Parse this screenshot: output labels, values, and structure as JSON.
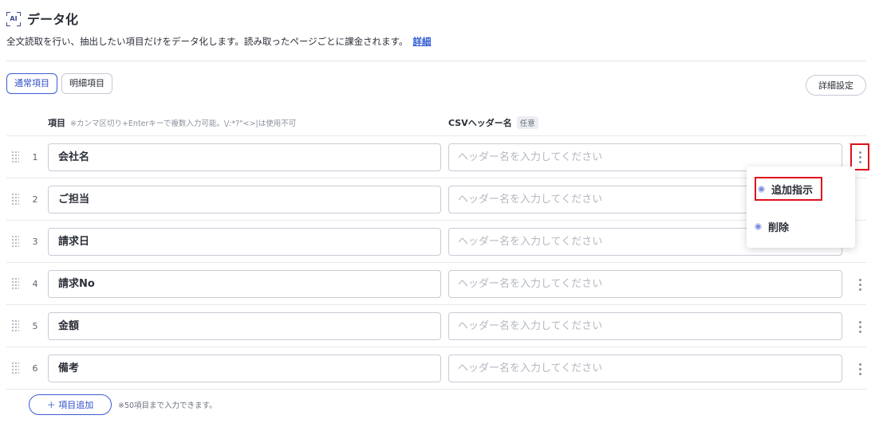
{
  "header": {
    "title": "データ化",
    "ai_label": "AI",
    "description": "全文読取を行い、抽出したい項目だけをデータ化します。読み取ったページごとに課金されます。",
    "detail_link": "詳細"
  },
  "tabs": [
    {
      "label": "通常項目",
      "active": true
    },
    {
      "label": "明細項目",
      "active": false
    }
  ],
  "detail_settings_label": "詳細設定",
  "columns": {
    "item_label": "項目",
    "item_note": "※カンマ区切り+Enterキーで複数入力可能。\\/:*?\"<>|は使用不可",
    "csv_label": "CSVヘッダー名",
    "csv_optional": "任意"
  },
  "rows": [
    {
      "num": "1",
      "name": "会社名",
      "csv_placeholder": "ヘッダー名を入力してください"
    },
    {
      "num": "2",
      "name": "ご担当",
      "csv_placeholder": "ヘッダー名を入力してください"
    },
    {
      "num": "3",
      "name": "請求日",
      "csv_placeholder": "ヘッダー名を入力してください"
    },
    {
      "num": "4",
      "name": "請求No",
      "csv_placeholder": "ヘッダー名を入力してください"
    },
    {
      "num": "5",
      "name": "金額",
      "csv_placeholder": "ヘッダー名を入力してください"
    },
    {
      "num": "6",
      "name": "備考",
      "csv_placeholder": "ヘッダー名を入力してください"
    }
  ],
  "context_menu": {
    "items": [
      {
        "label": "追加指示",
        "highlighted": true
      },
      {
        "label": "削除",
        "highlighted": false
      }
    ]
  },
  "footer": {
    "add_button": "＋ 項目追加",
    "limit_note": "※50項目まで入力できます。"
  },
  "colors": {
    "accent": "#3b5bd6",
    "highlight_border": "#e0101b"
  }
}
